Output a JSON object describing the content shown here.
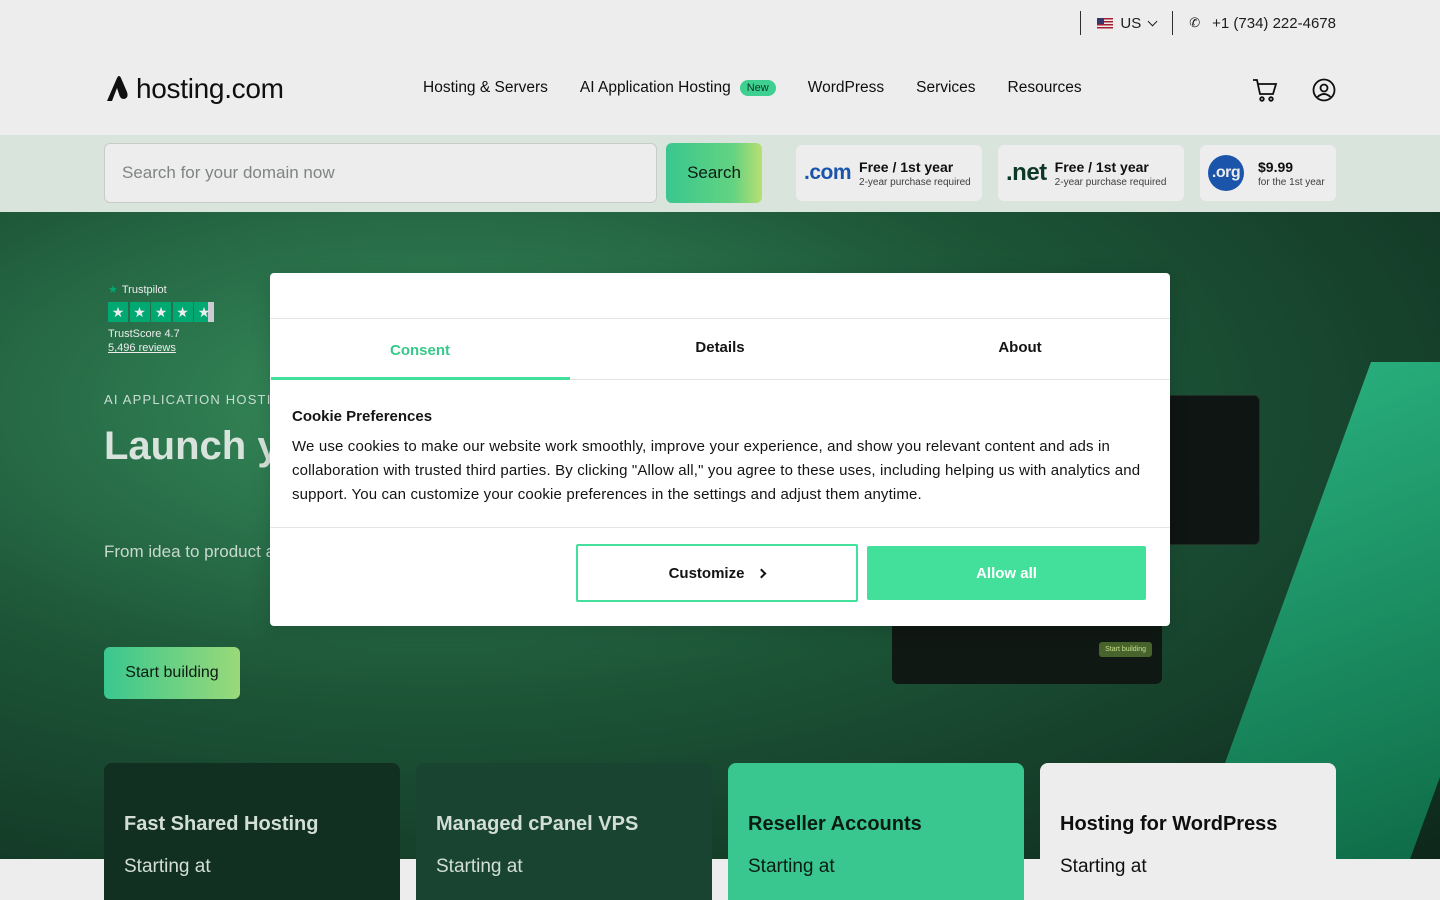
{
  "topbar": {
    "locale": "US",
    "phone": "+1 (734) 222-4678"
  },
  "header": {
    "logo_text": "hosting.com",
    "nav": [
      {
        "label": "Hosting & Servers"
      },
      {
        "label": "AI Application Hosting",
        "badge": "New"
      },
      {
        "label": "WordPress"
      },
      {
        "label": "Services"
      },
      {
        "label": "Resources"
      }
    ]
  },
  "domain_search": {
    "placeholder": "Search for your domain now",
    "button_label": "Search",
    "tlds": [
      {
        "name": ".com",
        "offer": "Free / 1st year",
        "note": "2-year purchase required",
        "color": "#1e5bb8"
      },
      {
        "name": ".net",
        "offer": "Free / 1st year",
        "note": "2-year purchase required",
        "color": "#0f3d2b"
      },
      {
        "name": ".org",
        "offer": "$9.99",
        "note": "for the 1st year",
        "color": "#1e5bb8"
      }
    ]
  },
  "hero": {
    "trustpilot": {
      "label": "Trustpilot",
      "score": "TrustScore 4.7",
      "reviews": "5,496 reviews",
      "rating": 4.7
    },
    "eyebrow": "AI APPLICATION HOSTING",
    "headline": "Launch y We’ll run",
    "subcopy": "From idea to product apps with the infrastr on.",
    "cta_label": "Start building",
    "mock_cta": "Start building"
  },
  "products": [
    {
      "title": "Fast Shared Hosting",
      "starting": "Starting at"
    },
    {
      "title": "Managed cPanel VPS",
      "starting": "Starting at"
    },
    {
      "title": "Reseller Accounts",
      "starting": "Starting at"
    },
    {
      "title": "Hosting for WordPress",
      "starting": "Starting at"
    }
  ],
  "cookie_dialog": {
    "tabs": [
      {
        "label": "Consent"
      },
      {
        "label": "Details"
      },
      {
        "label": "About"
      }
    ],
    "active_tab": "Consent",
    "heading": "Cookie Preferences",
    "body": "We use cookies to make our website work smoothly, improve your experience, and show you relevant content and ads in collaboration with trusted third parties. By clicking \"Allow all,\" you agree to these uses, including helping us with analytics and support. You can customize your cookie preferences in the settings and adjust them anytime.",
    "customize_label": "Customize",
    "allow_label": "Allow all",
    "accent_color": "#43e09b"
  }
}
